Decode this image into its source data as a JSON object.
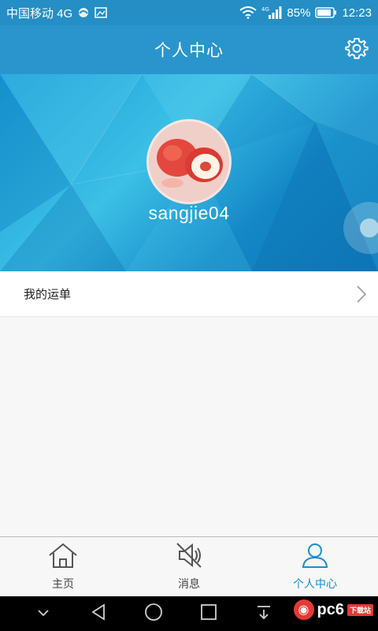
{
  "status_bar": {
    "carrier": "中国移动 4G",
    "network": "4G",
    "battery": "85%",
    "time": "12:23"
  },
  "header": {
    "title": "个人中心",
    "settings_icon": "gear-icon"
  },
  "profile": {
    "username": "sangjie04",
    "avatar_icon": "peach-avatar"
  },
  "menu": {
    "items": [
      {
        "label": "我的运单",
        "icon": "chevron-right-icon"
      }
    ]
  },
  "tabs": [
    {
      "label": "主页",
      "icon": "home-icon",
      "active": false
    },
    {
      "label": "消息",
      "icon": "speaker-muted-icon",
      "active": false
    },
    {
      "label": "个人中心",
      "icon": "user-icon",
      "active": true
    }
  ],
  "watermark": {
    "text": "pc6",
    "sub": "下载站"
  },
  "colors": {
    "primary": "#2a95cd",
    "active_tab": "#1a8fcf",
    "banner_dark": "#0e76b5",
    "banner_light": "#3cc0e6"
  }
}
